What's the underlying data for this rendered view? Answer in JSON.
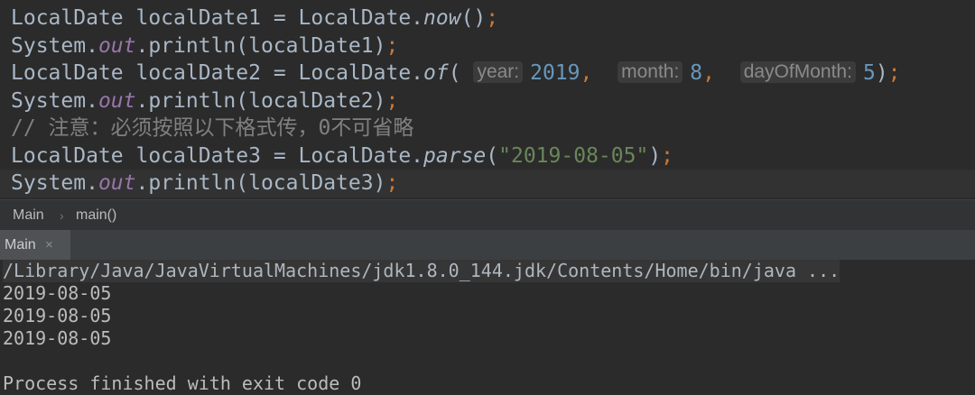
{
  "editor": {
    "line1": {
      "type": "LocalDate",
      "var": "localDate1",
      "eq": "=",
      "cls": "LocalDate.",
      "method": "now",
      "args": "()",
      "semi": ";"
    },
    "line2": {
      "obj": "System.",
      "field": "out",
      "call": ".println(localDate1)",
      "semi": ";"
    },
    "line3": {
      "type": "LocalDate",
      "var": "localDate2",
      "eq": "=",
      "cls": "LocalDate.",
      "method": "of",
      "open": "(",
      "hint_year": "year:",
      "year": "2019",
      "comma1": ",",
      "hint_month": "month:",
      "month": "8",
      "comma2": ",",
      "hint_day": "dayOfMonth:",
      "day": "5",
      "close": ")",
      "semi": ";"
    },
    "line4": {
      "obj": "System.",
      "field": "out",
      "call": ".println(localDate2)",
      "semi": ";"
    },
    "line5": {
      "comment": "// 注意：必须按照以下格式传，0不可省略"
    },
    "line6": {
      "type": "LocalDate",
      "var": "localDate3",
      "eq": "=",
      "cls": "LocalDate.",
      "method": "parse",
      "open": "(",
      "str": "\"2019-08-05\"",
      "close": ")",
      "semi": ";"
    },
    "line7": {
      "obj": "System.",
      "field": "out",
      "call": ".println(localDate3)",
      "semi": ";"
    }
  },
  "breadcrumb": {
    "class": "Main",
    "sep": "›",
    "method": "main()"
  },
  "run": {
    "tab_label": "Main",
    "close": "×"
  },
  "console": {
    "command": "/Library/Java/JavaVirtualMachines/jdk1.8.0_144.jdk/Contents/Home/bin/java ...",
    "outputs": [
      "2019-08-05",
      "2019-08-05",
      "2019-08-05"
    ],
    "exit": "Process finished with exit code 0"
  },
  "colors": {
    "background": "#2b2b2b",
    "keyword": "#cc7832",
    "number": "#6897bb",
    "string": "#6a8759",
    "field": "#9876aa",
    "comment": "#808080"
  }
}
